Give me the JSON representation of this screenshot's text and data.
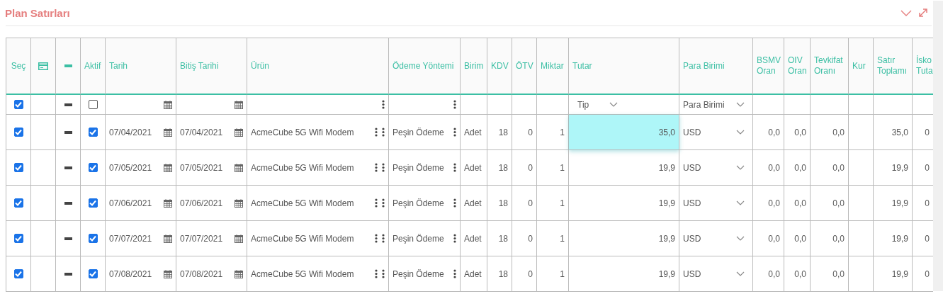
{
  "panel": {
    "title": "Plan Satırları"
  },
  "columns": [
    {
      "kind": "text",
      "label": "Seç"
    },
    {
      "kind": "card-icon"
    },
    {
      "kind": "minus-icon"
    },
    {
      "kind": "text",
      "label": "Aktif"
    },
    {
      "kind": "text",
      "label": "Tarih"
    },
    {
      "kind": "text",
      "label": "Bitiş Tarihi"
    },
    {
      "kind": "text",
      "label": "Ürün"
    },
    {
      "kind": "text",
      "label": "Ödeme Yöntemi"
    },
    {
      "kind": "text",
      "label": "Birim"
    },
    {
      "kind": "text",
      "label": "KDV"
    },
    {
      "kind": "text",
      "label": "ÖTV"
    },
    {
      "kind": "text",
      "label": "Miktar"
    },
    {
      "kind": "text",
      "label": "Tutar"
    },
    {
      "kind": "text",
      "label": "Para Birimi"
    },
    {
      "kind": "text",
      "label": "BSMV Oran"
    },
    {
      "kind": "text",
      "label": "OIV Oran"
    },
    {
      "kind": "text",
      "label": "Tevkifat Oranı"
    },
    {
      "kind": "text",
      "label": "Kur"
    },
    {
      "kind": "text",
      "label": "Satır Toplamı"
    },
    {
      "kind": "text",
      "label": "İsko Tuta"
    }
  ],
  "filters": {
    "select_all_checked": true,
    "active_checked": false,
    "amount_type": {
      "placeholder": "Tip"
    },
    "currency": {
      "placeholder": "Para Birimi"
    }
  },
  "rows": [
    {
      "selected": true,
      "active": true,
      "date": "07/04/2021",
      "end_date": "07/04/2021",
      "product": "AcmeCube 5G Wifi Modem",
      "payment": "Peşin Ödeme",
      "unit": "Adet",
      "kdv": "18",
      "otv": "0",
      "quantity": "1",
      "amount": {
        "value": "35,0",
        "selected": true
      },
      "currency": "USD",
      "bsmv": "0,0",
      "oiv": "0,0",
      "tevkifat": "0,0",
      "line_total": "35,0",
      "discount": "0"
    },
    {
      "selected": true,
      "active": true,
      "date": "07/05/2021",
      "end_date": "07/05/2021",
      "product": "AcmeCube 5G Wifi Modem",
      "payment": "Peşin Ödeme",
      "unit": "Adet",
      "kdv": "18",
      "otv": "0",
      "quantity": "1",
      "amount": {
        "value": "19,9",
        "selected": false
      },
      "currency": "USD",
      "bsmv": "0,0",
      "oiv": "0,0",
      "tevkifat": "0,0",
      "line_total": "19,9",
      "discount": "0"
    },
    {
      "selected": true,
      "active": true,
      "date": "07/06/2021",
      "end_date": "07/06/2021",
      "product": "AcmeCube 5G Wifi Modem",
      "payment": "Peşin Ödeme",
      "unit": "Adet",
      "kdv": "18",
      "otv": "0",
      "quantity": "1",
      "amount": {
        "value": "19,9",
        "selected": false
      },
      "currency": "USD",
      "bsmv": "0,0",
      "oiv": "0,0",
      "tevkifat": "0,0",
      "line_total": "19,9",
      "discount": "0"
    },
    {
      "selected": true,
      "active": true,
      "date": "07/07/2021",
      "end_date": "07/07/2021",
      "product": "AcmeCube 5G Wifi Modem",
      "payment": "Peşin Ödeme",
      "unit": "Adet",
      "kdv": "18",
      "otv": "0",
      "quantity": "1",
      "amount": {
        "value": "19,9",
        "selected": false
      },
      "currency": "USD",
      "bsmv": "0,0",
      "oiv": "0,0",
      "tevkifat": "0,0",
      "line_total": "19,9",
      "discount": "0"
    },
    {
      "selected": true,
      "active": true,
      "date": "07/08/2021",
      "end_date": "07/08/2021",
      "product": "AcmeCube 5G Wifi Modem",
      "payment": "Peşin Ödeme",
      "unit": "Adet",
      "kdv": "18",
      "otv": "0",
      "quantity": "1",
      "amount": {
        "value": "19,9",
        "selected": false
      },
      "currency": "USD",
      "bsmv": "0,0",
      "oiv": "0,0",
      "tevkifat": "0,0",
      "line_total": "19,9",
      "discount": "0"
    }
  ]
}
